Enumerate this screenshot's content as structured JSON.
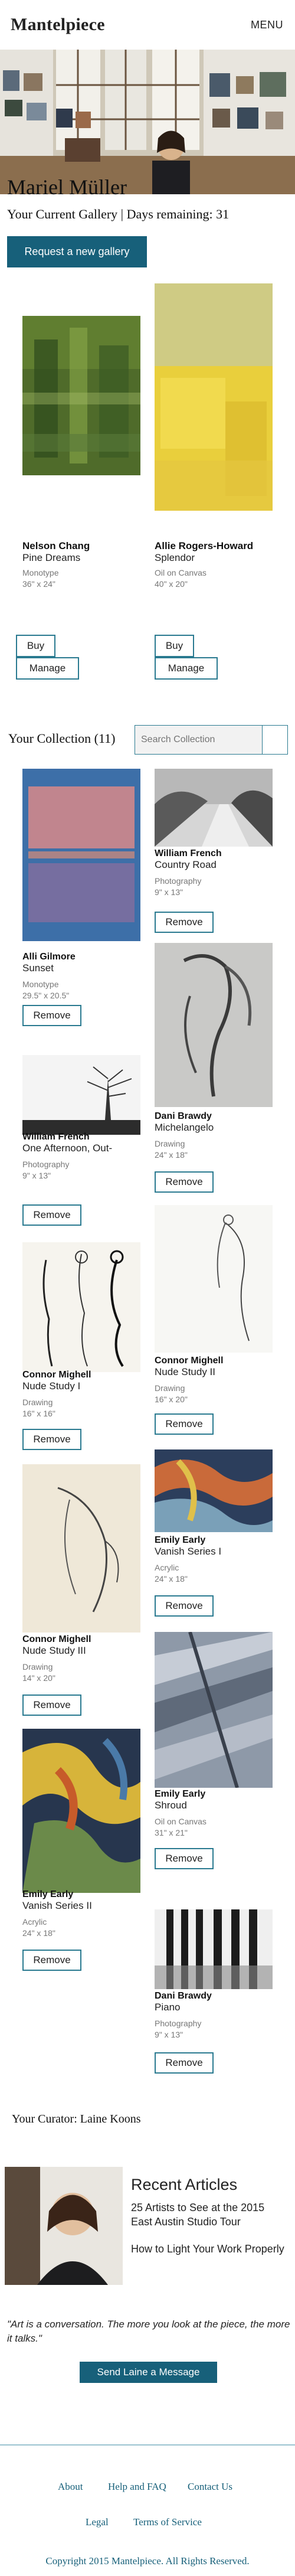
{
  "header": {
    "brand": "Mantelpiece",
    "menu_label": "MENU"
  },
  "gallery": {
    "owner_name": "Mariel Müller",
    "status": "Your Current Gallery | Days remaining: 31",
    "request_button": "Request a new gallery"
  },
  "current_works": [
    {
      "artist": "Nelson Chang",
      "title": "Pine Dreams",
      "medium": "Monotype",
      "size": "36\" x 24\"",
      "buy_label": "Buy",
      "manage_label": "Manage"
    },
    {
      "artist": "Allie Rogers-Howard",
      "title": "Splendor",
      "medium": "Oil on Canvas",
      "size": "40\" x 20\"",
      "buy_label": "Buy",
      "manage_label": "Manage"
    }
  ],
  "collection": {
    "heading": "Your Collection (11)",
    "search_placeholder": "Search Collection",
    "remove_label": "Remove",
    "items": [
      {
        "artist": "Alli Gilmore",
        "title": "Sunset",
        "medium": "Monotype",
        "size": "29.5\" x 20.5\""
      },
      {
        "artist": "William French",
        "title": "Country Road",
        "medium": "Photography",
        "size": "9\" x 13\""
      },
      {
        "artist": "William French",
        "title": "One Afternoon, Out-",
        "medium": "Photography",
        "size": "9\" x 13\""
      },
      {
        "artist": "Dani Brawdy",
        "title": "Michelangelo",
        "medium": "Drawing",
        "size": "24\" x 18\""
      },
      {
        "artist": "Connor Mighell",
        "title": "Nude Study I",
        "medium": "Drawing",
        "size": "16\" x 16\""
      },
      {
        "artist": "Connor Mighell",
        "title": "Nude Study II",
        "medium": "Drawing",
        "size": "16\" x 20\""
      },
      {
        "artist": "Connor Mighell",
        "title": "Nude Study III",
        "medium": "Drawing",
        "size": "14\" x 20\""
      },
      {
        "artist": "Emily Early",
        "title": "Vanish Series I",
        "medium": "Acrylic",
        "size": "24\" x 18\""
      },
      {
        "artist": "Emily Early",
        "title": "Shroud",
        "medium": "Oil on Canvas",
        "size": "31\" x 21\""
      },
      {
        "artist": "Emily Early",
        "title": "Vanish Series II",
        "medium": "Acrylic",
        "size": "24\" x 18\""
      },
      {
        "artist": "Dani Brawdy",
        "title": "Piano",
        "medium": "Photography",
        "size": "9\" x 13\""
      }
    ]
  },
  "curator": {
    "heading": "Your Curator: Laine Koons",
    "recent_heading": "Recent Articles",
    "articles": [
      "25 Artists to See at the 2015 East Austin Studio Tour",
      "How to Light Your Work Properly"
    ],
    "quote": "\"Art is a conversation. The more you look at the piece, the more it talks.\"",
    "message_button": "Send Laine a Message"
  },
  "footer": {
    "links": [
      "About",
      "Help and FAQ",
      "Contact Us",
      "Legal",
      "Terms of Service"
    ],
    "copyright": "Copyright 2015 Mantelpiece. All Rights Reserved."
  },
  "colors": {
    "accent": "#17607a",
    "outline": "#2a7a90",
    "footer_rule": "#9bc4d0"
  }
}
